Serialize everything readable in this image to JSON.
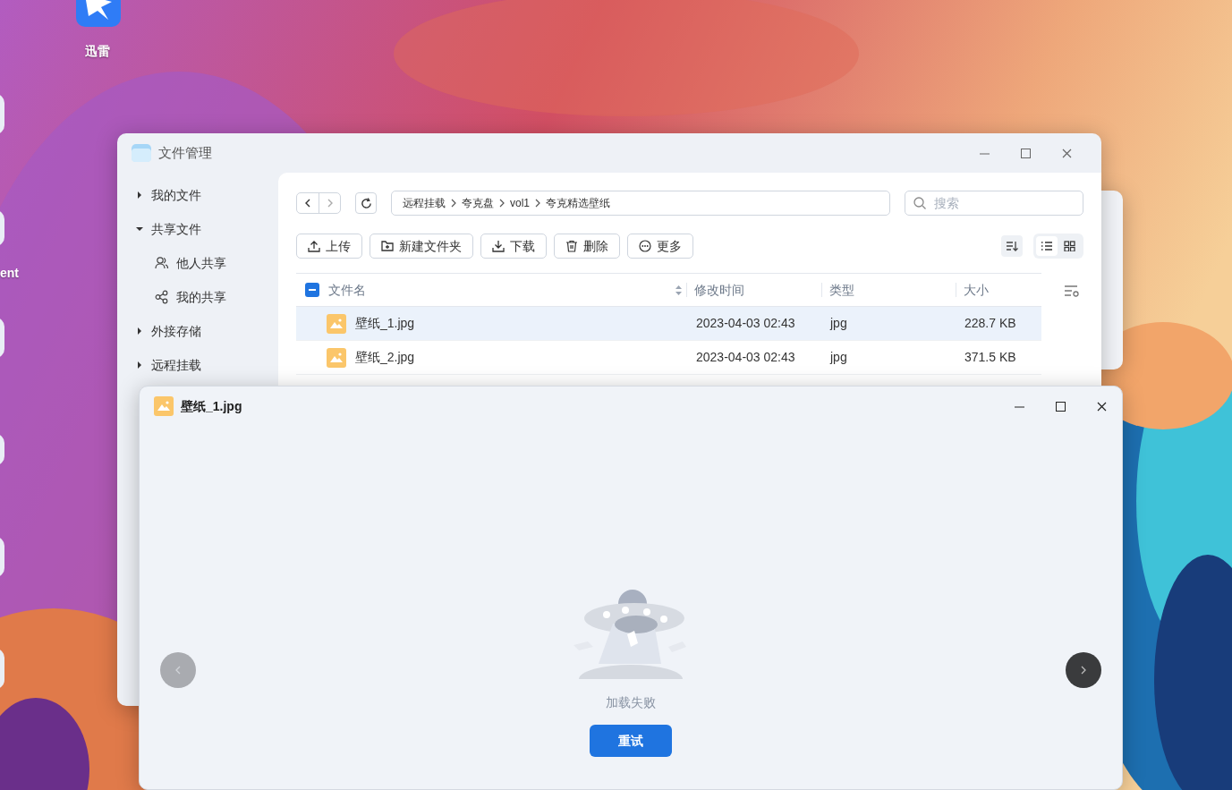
{
  "desktop": {
    "icons": [
      {
        "label": "迅雷"
      },
      {
        "label": "ent"
      }
    ]
  },
  "file_manager": {
    "title": "文件管理",
    "sidebar": {
      "items": [
        {
          "label": "我的文件",
          "expanded": false
        },
        {
          "label": "共享文件",
          "expanded": true,
          "children": [
            {
              "label": "他人共享",
              "kind": "people"
            },
            {
              "label": "我的共享",
              "kind": "share"
            }
          ]
        },
        {
          "label": "外接存储",
          "expanded": false
        },
        {
          "label": "远程挂载",
          "expanded": false
        }
      ]
    },
    "breadcrumb": [
      "远程挂载",
      "夸克盘",
      "vol1",
      "夸克精选壁纸"
    ],
    "search": {
      "placeholder": "搜索"
    },
    "toolbar": [
      {
        "label": "上传",
        "kind": "upload"
      },
      {
        "label": "新建文件夹",
        "kind": "new-folder"
      },
      {
        "label": "下载",
        "kind": "download"
      },
      {
        "label": "删除",
        "kind": "delete"
      },
      {
        "label": "更多",
        "kind": "more"
      }
    ],
    "view_modes": [
      {
        "kind": "list",
        "selected": true
      },
      {
        "kind": "grid",
        "selected": false
      }
    ],
    "table": {
      "select_all": {
        "indeterminate": true
      },
      "columns": [
        "文件名",
        "修改时间",
        "类型",
        "大小"
      ],
      "rows": [
        {
          "name": "壁纸_1.jpg",
          "modified": "2023-04-03 02:43",
          "type": "jpg",
          "size": "228.7 KB",
          "selected": true
        },
        {
          "name": "壁纸_2.jpg",
          "modified": "2023-04-03 02:43",
          "type": "jpg",
          "size": "371.5 KB",
          "selected": false
        }
      ]
    }
  },
  "viewer": {
    "title": "壁纸_1.jpg",
    "message": "加载失败",
    "button": "重试"
  }
}
